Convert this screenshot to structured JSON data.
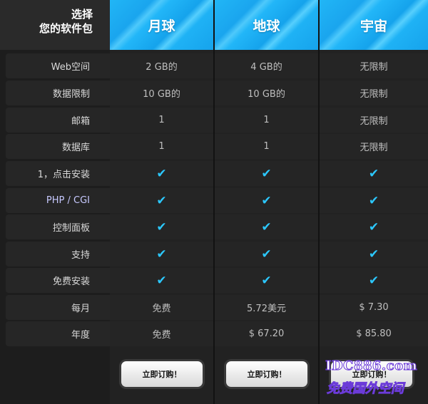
{
  "corner": {
    "line1": "选择",
    "line2": "您的软件包"
  },
  "features": [
    {
      "label": "Web空间"
    },
    {
      "label": "数据限制"
    },
    {
      "label": "邮箱"
    },
    {
      "label": "数据库"
    },
    {
      "label": "1，点击安装"
    },
    {
      "label": "PHP / CGI"
    },
    {
      "label": "控制面板"
    },
    {
      "label": "支持"
    },
    {
      "label": "免费安装"
    },
    {
      "label": "每月"
    },
    {
      "label": "年度"
    }
  ],
  "plans": [
    {
      "name": "月球",
      "values": [
        "2 GB的",
        "10 GB的",
        "1",
        "1",
        "✔",
        "✔",
        "✔",
        "✔",
        "✔",
        "免费",
        "免费"
      ],
      "button": "立即订购！"
    },
    {
      "name": "地球",
      "values": [
        "4 GB的",
        "10 GB的",
        "1",
        "1",
        "✔",
        "✔",
        "✔",
        "✔",
        "✔",
        "5.72美元",
        "$ 67.20"
      ],
      "button": "立即订购！"
    },
    {
      "name": "宇宙",
      "values": [
        "无限制",
        "无限制",
        "无限制",
        "无限制",
        "✔",
        "✔",
        "✔",
        "✔",
        "✔",
        "$ 7.30",
        "$ 85.80"
      ],
      "button": "立即订购！"
    }
  ],
  "watermark": {
    "line1": "IDC886.com",
    "line2": "免费国外空间"
  },
  "colors": {
    "header_blue": "#21b6f6",
    "check_cyan": "#2cc8ff",
    "bg": "#1b1b1b"
  },
  "icons": {
    "included": "check-icon"
  }
}
